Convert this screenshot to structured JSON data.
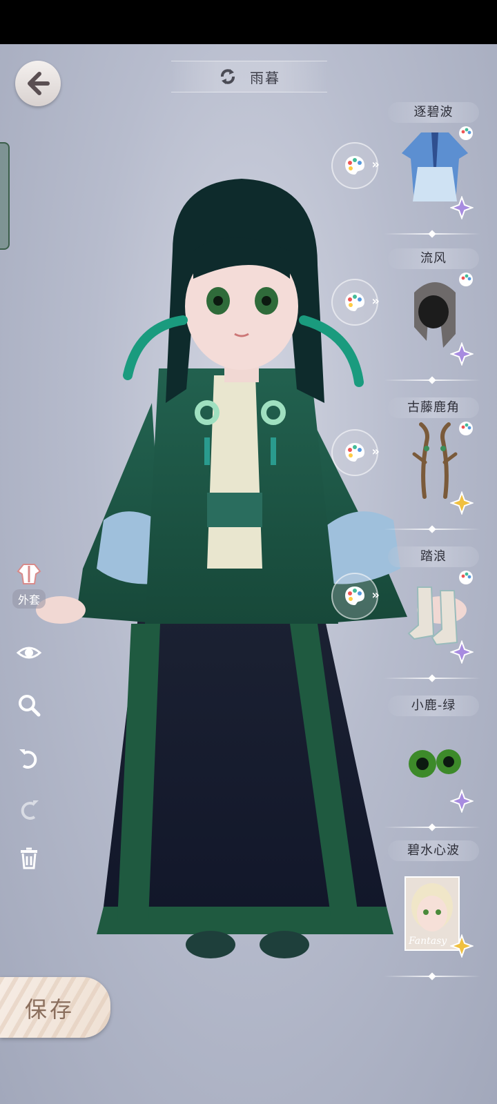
{
  "header": {
    "title": "雨暮"
  },
  "toolbar": {
    "coat_label": "外套",
    "save_label": "保存"
  },
  "items": [
    {
      "name": "逐碧波",
      "rarity": "purple"
    },
    {
      "name": "流风",
      "rarity": "purple"
    },
    {
      "name": "古藤鹿角",
      "rarity": "gold"
    },
    {
      "name": "踏浪",
      "rarity": "purple"
    },
    {
      "name": "小鹿-绿",
      "rarity": "purple"
    },
    {
      "name": "碧水心波",
      "rarity": "gold",
      "card_text": "Fantasy"
    }
  ],
  "colors": {
    "robe_green": "#1f5a4a",
    "skirt_navy": "#1c2233",
    "accent_purple": "#a78be0",
    "accent_gold": "#f0c040"
  }
}
